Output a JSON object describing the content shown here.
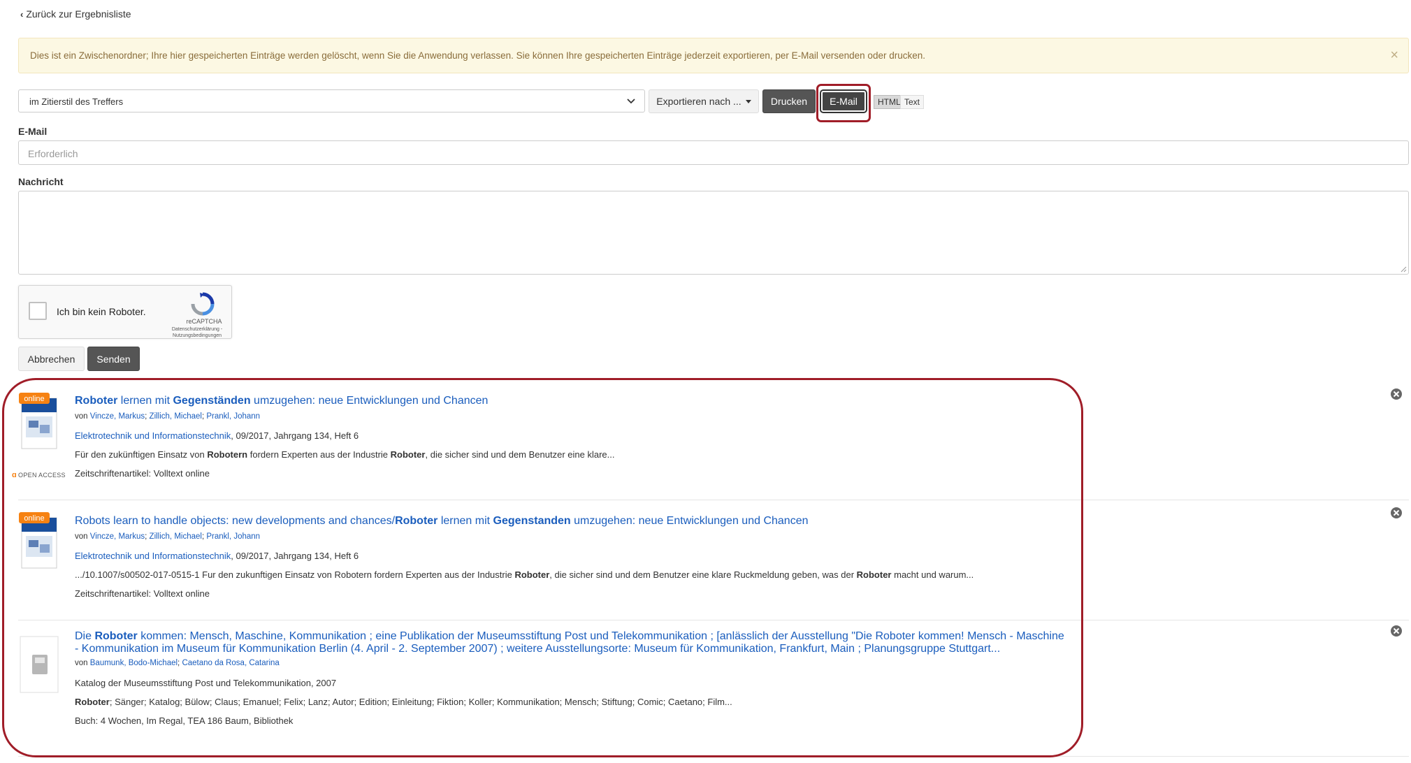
{
  "nav": {
    "back_label": "Zurück zur Ergebnisliste"
  },
  "alert": {
    "message": "Dies ist ein Zwischenordner; Ihre hier gespeicherten Einträge werden gelöscht, wenn Sie die Anwendung verlassen. Sie können Ihre gespeicherten Einträge jederzeit exportieren, per E-Mail versenden oder drucken.",
    "close_label": "×"
  },
  "toolbar": {
    "citation_style": "im Zitierstil des Treffers",
    "export_label": "Exportieren nach ...",
    "print_label": "Drucken",
    "email_label": "E-Mail",
    "format_html": "HTML",
    "format_text": "Text"
  },
  "form": {
    "email_label": "E-Mail",
    "email_placeholder": "Erforderlich",
    "message_label": "Nachricht",
    "captcha_text": "Ich bin kein Roboter.",
    "captcha_brand": "reCAPTCHA",
    "captcha_links": "Datenschutzerklärung - Nutzungsbedingungen",
    "cancel_label": "Abbrechen",
    "send_label": "Senden"
  },
  "results": [
    {
      "title_parts": [
        {
          "t": "Roboter",
          "b": true
        },
        {
          "t": " lernen mit ",
          "b": false
        },
        {
          "t": "Gegenständen",
          "b": true
        },
        {
          "t": " umzugehen: neue Entwicklungen und Chancen",
          "b": false
        }
      ],
      "authors_prefix": "von ",
      "authors": [
        "Vincze, Markus",
        "Zillich, Michael",
        "Prankl, Johann"
      ],
      "source_link": "Elektrotechnik und Informationstechnik",
      "source_rest": ", 09/2017, Jahrgang 134, Heft 6",
      "snippet_parts": [
        {
          "t": "Für den zukünftigen Einsatz von ",
          "b": false
        },
        {
          "t": "Robotern",
          "b": true
        },
        {
          "t": " fordern Experten aus der Industrie ",
          "b": false
        },
        {
          "t": "Roboter",
          "b": true
        },
        {
          "t": ", die sicher sind und dem Benutzer eine klare...",
          "b": false
        }
      ],
      "type_label": "Zeitschriftenartikel: ",
      "access_link": "Volltext online",
      "badge": "online",
      "open_access": "OPEN ACCESS"
    },
    {
      "title_parts": [
        {
          "t": "Robots learn to handle objects: new developments and chances/",
          "b": false
        },
        {
          "t": "Roboter",
          "b": true
        },
        {
          "t": " lernen mit ",
          "b": false
        },
        {
          "t": "Gegenstanden",
          "b": true
        },
        {
          "t": " umzugehen: neue Entwicklungen und Chancen",
          "b": false
        }
      ],
      "authors_prefix": "von ",
      "authors": [
        "Vincze, Markus",
        "Zillich, Michael",
        "Prankl, Johann"
      ],
      "source_link": "Elektrotechnik und Informationstechnik",
      "source_rest": ", 09/2017, Jahrgang 134, Heft 6",
      "snippet_parts": [
        {
          "t": ".../10.1007/s00502-017-0515-1 Fur den zukunftigen Einsatz von Robotern fordern Experten aus der Industrie ",
          "b": false
        },
        {
          "t": "Roboter",
          "b": true
        },
        {
          "t": ", die sicher sind und dem Benutzer eine klare Ruckmeldung geben, was der ",
          "b": false
        },
        {
          "t": "Roboter",
          "b": true
        },
        {
          "t": " macht und warum...",
          "b": false
        }
      ],
      "type_label": "Zeitschriftenartikel: ",
      "access_link": "Volltext online",
      "badge": "online"
    },
    {
      "title_parts": [
        {
          "t": "Die ",
          "b": false
        },
        {
          "t": "Roboter",
          "b": true
        },
        {
          "t": " kommen: Mensch, Maschine, Kommunikation ; eine Publikation der Museumsstiftung Post und Telekommunikation ; [anlässlich der Ausstellung \"Die Roboter kommen! Mensch - Maschine - Kommunikation im Museum für Kommunikation Berlin (4. April - 2. September 2007) ; weitere Ausstellungsorte: Museum für Kommunikation, Frankfurt, Main ; Planungsgruppe Stuttgart...",
          "b": false
        }
      ],
      "authors_prefix": "von ",
      "authors": [
        "Baumunk, Bodo-Michael",
        "Caetano da Rosa, Catarina"
      ],
      "source_plain": "Katalog der Museumsstiftung Post und Telekommunikation, 2007",
      "snippet_parts": [
        {
          "t": "Roboter",
          "b": true
        },
        {
          "t": "; Sänger; Katalog; Bülow; Claus; Emanuel; Felix; Lanz; Autor; Edition; Einleitung; Fiktion; Koller; Kommunikation; Mensch; Stiftung; Comic; Caetano; Film...",
          "b": false
        }
      ],
      "type_label": "Buch: ",
      "access_link": "4 Wochen, Im Regal, TEA 186 Baum, Bibliothek"
    }
  ],
  "colors": {
    "link": "#1a5dbd",
    "highlight": "#a01d28",
    "alert_bg": "#fcf8e3",
    "alert_text": "#8a6d3b",
    "badge": "#f68212"
  }
}
